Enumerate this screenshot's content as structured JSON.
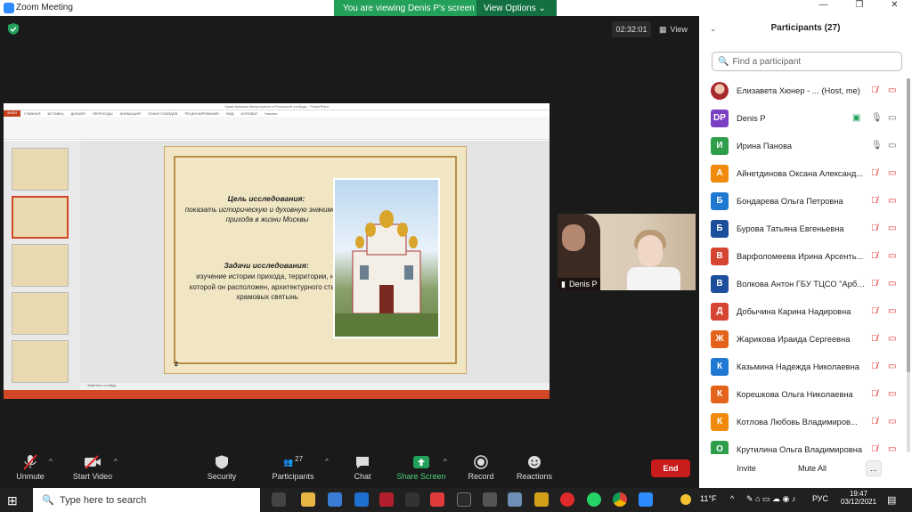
{
  "window": {
    "title": "Zoom Meeting"
  },
  "banner": {
    "viewing_text": "You are viewing Denis P's screen",
    "view_options_label": "View Options"
  },
  "meeting": {
    "timer": "02:32:01",
    "view_label": "View"
  },
  "video": {
    "name": "Denis P"
  },
  "slide": {
    "goal_title": "Цель исследования:",
    "goal_text": "показать историческую и духовную значимость прихода в жизни Москвы",
    "tasks_title": "Задачи исследования:",
    "tasks_text": "изучение истории прихода, территории, на которой он расположен, архитектурного стиля, храмовых святынь",
    "number": "2",
    "notes_label": "Заметки к слайду",
    "ppt_title": "Храм Алексия Митрополита в Рогожской слободе - PowerPoint",
    "ppt_tabs": [
      "ФАЙЛ",
      "ГЛАВНАЯ",
      "ВСТАВКА",
      "ДИЗАЙН",
      "ПЕРЕХОДЫ",
      "АНИМАЦИЯ",
      "ПОКАЗ СЛАЙДОВ",
      "РЕЦЕНЗИРОВАНИЕ",
      "ВИД",
      "ACROBAT",
      "Начало"
    ]
  },
  "toolbar": {
    "unmute": "Unmute",
    "start_video": "Start Video",
    "security": "Security",
    "participants": "Participants",
    "participants_count": "27",
    "chat": "Chat",
    "share_screen": "Share Screen",
    "record": "Record",
    "reactions": "Reactions",
    "end": "End"
  },
  "panel": {
    "header": "Participants (27)",
    "search_placeholder": "Find a participant",
    "participants": [
      {
        "initials": "",
        "name": "Елизавета Хюнер - ...",
        "tag": "(Host, me)",
        "color": "#c0392b",
        "photo": true
      },
      {
        "initials": "DP",
        "name": "Denis P",
        "tag": "",
        "color": "#7a3fc2",
        "sharing": true
      },
      {
        "initials": "И",
        "name": "Ирина Панова",
        "tag": "",
        "color": "#2e9e4a"
      },
      {
        "initials": "А",
        "name": "Айнетдинова Оксана Александ...",
        "tag": "",
        "color": "#f08a0c"
      },
      {
        "initials": "Б",
        "name": "Бондарева Ольга Петровна",
        "tag": "",
        "color": "#1f78d1"
      },
      {
        "initials": "Б",
        "name": "Бурова Татьяна Евгеньевна",
        "tag": "",
        "color": "#1b4f9c"
      },
      {
        "initials": "В",
        "name": "Варфоломеева Ирина Арсенть...",
        "tag": "",
        "color": "#d64532"
      },
      {
        "initials": "В",
        "name": "Волкова Антон ГБУ ТЦСО \"Арбат\"",
        "tag": "",
        "color": "#1b4f9c"
      },
      {
        "initials": "Д",
        "name": "Добычина Карина Надировна",
        "tag": "",
        "color": "#d64532"
      },
      {
        "initials": "Ж",
        "name": "Жарикова Ираида Сергеевна",
        "tag": "",
        "color": "#e3631a"
      },
      {
        "initials": "К",
        "name": "Казьмина Надежда Николаевна",
        "tag": "",
        "color": "#1f78d1"
      },
      {
        "initials": "К",
        "name": "Корешкова Ольга Николаевна",
        "tag": "",
        "color": "#e3631a"
      },
      {
        "initials": "К",
        "name": "Котлова Любовь Владимиров...",
        "tag": "",
        "color": "#f08a0c"
      },
      {
        "initials": "О",
        "name": "Крутилина Ольга Владимировна",
        "tag": "",
        "color": "#2e9e4a"
      }
    ],
    "invite": "Invite",
    "mute_all": "Mute All",
    "more": "..."
  },
  "taskbar": {
    "search_placeholder": "Type here to search",
    "temperature": "11°F",
    "language": "РУС",
    "time": "19:47",
    "date": "03/12/2021"
  },
  "colors": {
    "zoom_blue": "#2d8cff",
    "green": "#23a05a",
    "end_red": "#c91c1c",
    "ppt_red": "#d24726"
  }
}
